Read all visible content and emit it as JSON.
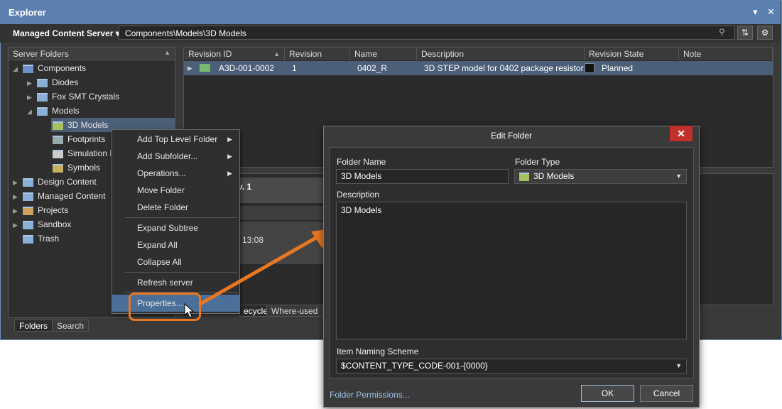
{
  "window": {
    "title": "Explorer"
  },
  "toolbar": {
    "server_label": "Managed Content Server",
    "server_caret": "▾",
    "path": "Components\\Models\\3D Models"
  },
  "left_pane": {
    "header": "Server Folders",
    "tree": [
      {
        "label": "Components"
      },
      {
        "label": "Diodes"
      },
      {
        "label": "Fox SMT Crystals"
      },
      {
        "label": "Models"
      },
      {
        "label": "3D Models"
      },
      {
        "label": "Footprints"
      },
      {
        "label": "Simulation M"
      },
      {
        "label": "Symbols"
      },
      {
        "label": "Design Content"
      },
      {
        "label": "Managed Content"
      },
      {
        "label": "Projects"
      },
      {
        "label": "Sandbox"
      },
      {
        "label": "Trash"
      }
    ],
    "tabs": [
      "Folders",
      "Search"
    ]
  },
  "grid": {
    "columns": [
      "Revision ID",
      "Revision",
      "Name",
      "Description",
      "Revision State",
      "Note"
    ],
    "row": {
      "revision_id": "A3D-001-0002",
      "revision": "1",
      "name": "0402_R",
      "description": "3D STEP model for 0402 package resistor",
      "state": "Planned"
    }
  },
  "lower": {
    "heading": "v. 1",
    "time": "13:08",
    "tabs": [
      "ecycle",
      "Where-used"
    ]
  },
  "context_menu": {
    "items": [
      "Add Top Level Folder",
      "Add Subfolder...",
      "Operations...",
      "Move Folder",
      "Delete Folder",
      "Expand Subtree",
      "Expand All",
      "Collapse All",
      "Refresh server",
      "Properties..."
    ]
  },
  "dialog": {
    "title": "Edit Folder",
    "folder_name_label": "Folder Name",
    "folder_name": "3D Models",
    "folder_type_label": "Folder Type",
    "folder_type": "3D Models",
    "description_label": "Description",
    "description": "3D Models",
    "naming_label": "Item Naming Scheme",
    "naming": "$CONTENT_TYPE_CODE-001-{0000}",
    "permissions_link": "Folder Permissions...",
    "ok": "OK",
    "cancel": "Cancel"
  },
  "colors": {
    "title_bar": "#5b7fae",
    "selection": "#4b5f78",
    "highlight": "#e87722",
    "close": "#c1302b"
  }
}
